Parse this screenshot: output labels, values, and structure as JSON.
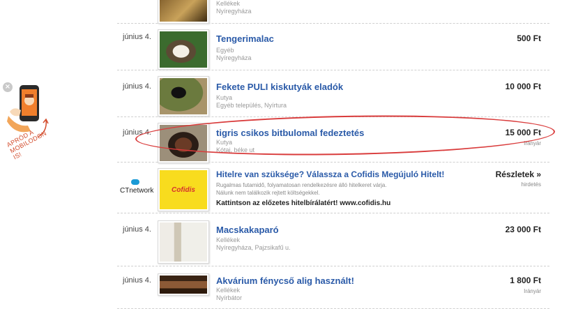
{
  "promo": {
    "close_icon": "close-icon",
    "label_line1": "Apród a",
    "label_line2": "mobilodon is!"
  },
  "listings": [
    {
      "date": "",
      "title": "",
      "category": "Kellékek",
      "location": "Nyíregyháza",
      "price": "",
      "sub": ""
    },
    {
      "date": "június 4.",
      "title": "Tengerimalac",
      "category": "Egyéb",
      "location": "Nyíregyháza",
      "price": "500 Ft",
      "sub": ""
    },
    {
      "date": "június 4.",
      "title": "Fekete PULI kiskutyák eladók",
      "category": "Kutya",
      "location": "Egyéb település, Nyírtura",
      "price": "10 000 Ft",
      "sub": ""
    },
    {
      "date": "június 4.",
      "title": "tigris csikos bitbulomal fedeztetés",
      "category": "Kutya",
      "location": "Kótaj, béke ut",
      "price": "15 000 Ft",
      "sub": "Irányár"
    },
    {
      "date": "június 4.",
      "title": "Macskakaparó",
      "category": "Kellékek",
      "location": "Nyíregyháza, Pajzsikafű u.",
      "price": "23 000 Ft",
      "sub": ""
    },
    {
      "date": "június 4.",
      "title": "Akvárium fénycső alig használt!",
      "category": "Kellékek",
      "location": "Nyírbátor",
      "price": "1 800 Ft",
      "sub": "Irányár"
    }
  ],
  "ad": {
    "network": "CTnetwork",
    "logo_text": "Cofidis",
    "title": "Hitelre van szüksége? Válassza a Cofidis Megújuló Hitelt!",
    "desc1": "Rugalmas futamidő, folyamatosan rendelkezésre álló hitelkeret várja.",
    "desc2": "Nálunk nem találkozik rejtett költségekkel.",
    "cta": "Kattintson az előzetes hitelbírálatért! www.cofidis.hu",
    "more": "Részletek »",
    "sub": "hirdetés"
  }
}
